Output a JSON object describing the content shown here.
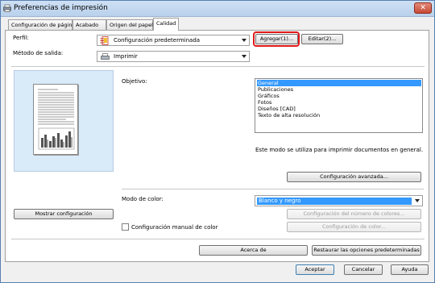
{
  "window": {
    "title": "Preferencias de impresión",
    "close_symbol": "✕"
  },
  "tabs": [
    {
      "label": "Configuración de página",
      "active": false
    },
    {
      "label": "Acabado",
      "active": false
    },
    {
      "label": "Origen del papel",
      "active": false
    },
    {
      "label": "Calidad",
      "active": true
    }
  ],
  "profile": {
    "label": "Perfil:",
    "value": "Configuración predeterminada",
    "add_button": "Agregar(1)...",
    "edit_button": "Editar(2)..."
  },
  "output": {
    "label": "Método de salida:",
    "value": "Imprimir"
  },
  "objective": {
    "label": "Objetivo:",
    "options": [
      "General",
      "Publicaciones",
      "Gráficos",
      "Fotos",
      "Diseños [CAD]",
      "Texto de alta resolución"
    ],
    "selected": "General",
    "description": "Este modo se utiliza para imprimir documentos en general."
  },
  "advanced_button": "Configuración avanzada...",
  "show_settings_button": "Mostrar configuración",
  "color": {
    "mode_label": "Modo de color:",
    "mode_value": "Blanco y negro",
    "number_of_colors_button": "Configuración del número de colores...",
    "manual_color_label": "Configuración manual de color",
    "manual_color_checked": false,
    "color_settings_button": "Configuración de color..."
  },
  "about_button": "Acerca de",
  "restore_button": "Restaurar las opciones predeterminadas",
  "footer": {
    "ok": "Aceptar",
    "cancel": "Cancelar",
    "help": "Ayuda"
  },
  "colors": {
    "highlight": "#e01818",
    "selection": "#3399ff",
    "preview_bg": "#d9eaf9"
  }
}
